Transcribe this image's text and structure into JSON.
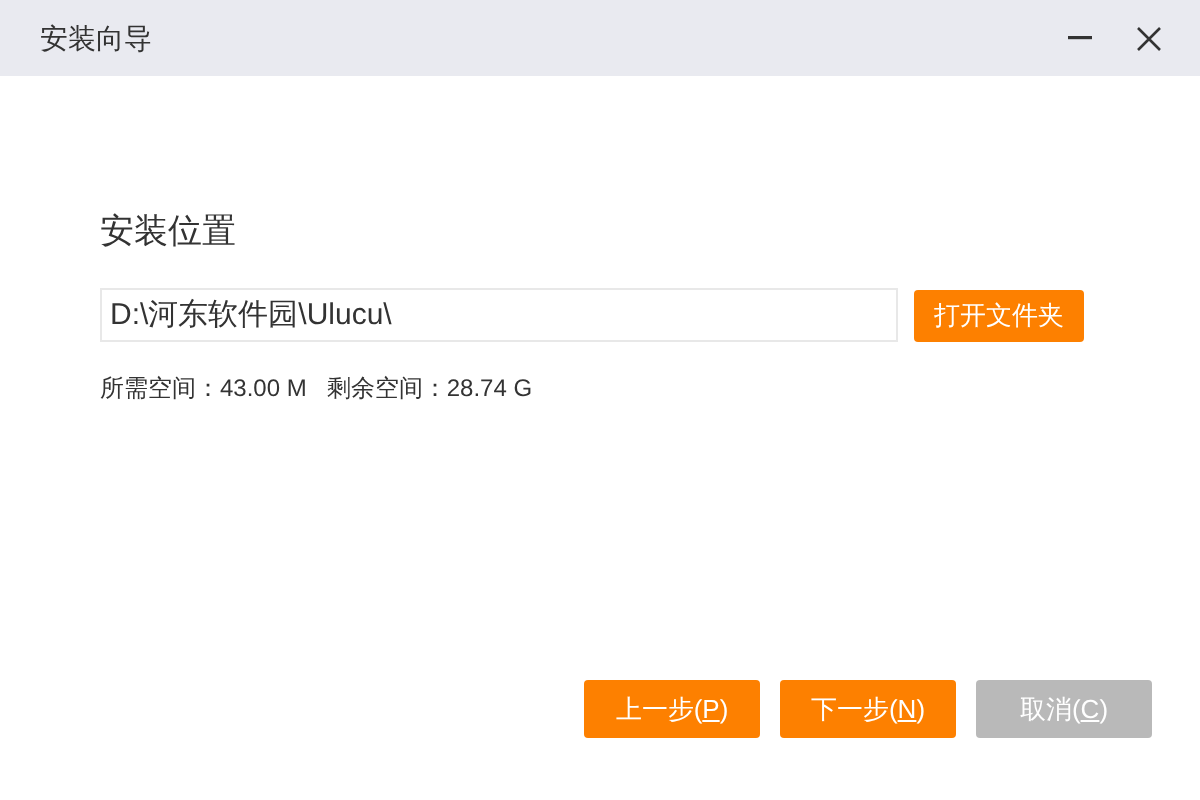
{
  "window": {
    "title": "安装向导"
  },
  "section_title": "安装位置",
  "path_field": {
    "value": "D:\\河东软件园\\Ulucu\\"
  },
  "browse_button": "打开文件夹",
  "space_info": [
    {
      "label": "所需空间：",
      "value": "43.00 M"
    },
    {
      "label": "剩余空间：",
      "value": "28.74 G"
    }
  ],
  "buttons": [
    {
      "prefix": "上一步(",
      "key": "P",
      "suffix": ")",
      "disabled": false
    },
    {
      "prefix": "下一步(",
      "key": "N",
      "suffix": ")",
      "disabled": false
    },
    {
      "prefix": "取消(",
      "key": "C",
      "suffix": ")",
      "disabled": true
    }
  ]
}
